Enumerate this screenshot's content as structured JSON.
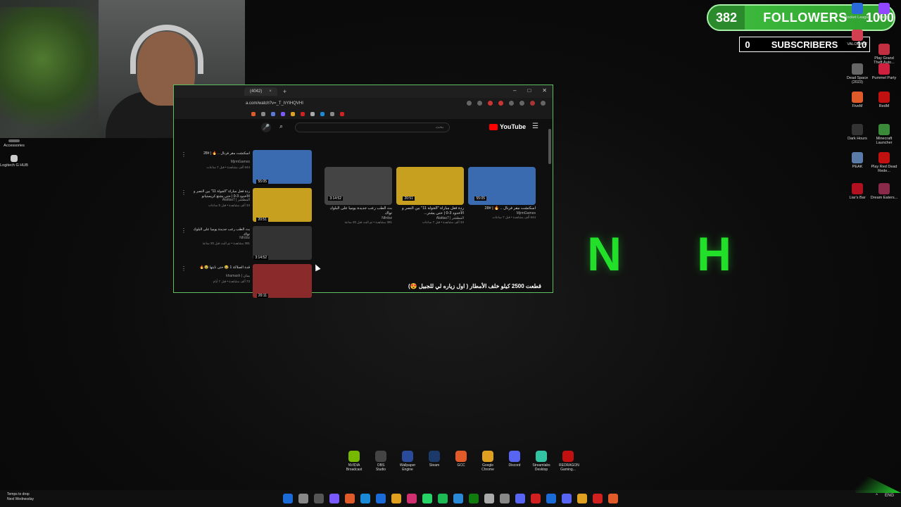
{
  "followers": {
    "count": "382",
    "label": "FOLLOWERS",
    "goal": "1000"
  },
  "subscribers": {
    "count": "0",
    "label": "SUBSCRIBERS",
    "goal": "10"
  },
  "big_letters": [
    "N",
    "H"
  ],
  "left_desktop": [
    {
      "label": "Accessories",
      "icon": "folder-icon"
    },
    {
      "label": "Logitech G HUB",
      "icon": "logitech-icon"
    }
  ],
  "right_desktop": [
    {
      "label": "Rocket League",
      "icon": "rocket-league-icon"
    },
    {
      "label": "Twitch",
      "icon": "twitch-icon"
    },
    {
      "label": "VALORANT",
      "icon": "valorant-icon"
    },
    {
      "label": "Play Grand Theft Auto...",
      "icon": "gta-icon"
    },
    {
      "label": "Dead Space (2023)",
      "icon": "dead-space-icon"
    },
    {
      "label": "Pummel Party",
      "icon": "pummel-party-icon"
    },
    {
      "label": "FiveM",
      "icon": "fivem-icon"
    },
    {
      "label": "RedM",
      "icon": "redm-icon"
    },
    {
      "label": "Dark Hours",
      "icon": "dark-hours-icon"
    },
    {
      "label": "Minecraft Launcher",
      "icon": "minecraft-icon"
    },
    {
      "label": "PEAK",
      "icon": "peak-icon"
    },
    {
      "label": "Play Red Dead Rede...",
      "icon": "rdr-icon"
    },
    {
      "label": "Liar's Bar",
      "icon": "liars-bar-icon"
    },
    {
      "label": "Dream Eaters...",
      "icon": "dream-eaters-icon"
    }
  ],
  "browser": {
    "tab_title": "(4042)",
    "url": "a.com/watch?v=_T_hYIHQVHI",
    "search_placeholder": "بحث",
    "logo": "YouTube",
    "sidebar": [
      {
        "title": "اسكتشت مقر فرنال .. 🔥 | #28",
        "channel": "MjrmGames",
        "meta": "644 ألف مشاهدة • قبل 7 ساعات",
        "duration": "55:05",
        "color": "#3a6ab0"
      },
      {
        "title": "ردة فعل مباراة \"الجولة 11\" بين النصر و الأخدود 3-0 | حتى يشتغ كريستيانو",
        "channel": "Alattas7 | المطشر",
        "meta": "34 ألف مشاهدة • قبل 5 ساعات",
        "duration": "20:51",
        "color": "#c8a020"
      },
      {
        "title": "بث الطب رعب جديدة يوميا على البلوك تواك",
        "channel": "Nfrdoz",
        "meta": "391 مشاهدة • تم البث قبل 20 ساعة",
        "duration": "3:14:52",
        "color": "#333"
      },
      {
        "title": "قدة الصلاكة 1 😂 حتى نايتها 😂🔥",
        "channel": "khamash | يمان",
        "meta": "73 ألف مشاهدة • قبل 7 أيام",
        "duration": "20:11",
        "color": "#8a2a2a"
      }
    ],
    "grid": [
      {
        "title": "اسكتشت مقر فرنال .. 🔥 | #28",
        "channel": "MjrmGames",
        "meta": "644 ألف مشاهدة • قبل 7 ساعات",
        "duration": "55:05",
        "color": "#3a6ab0"
      },
      {
        "title": "ردة فعل مباراة \"الجولة 11\" بين النصر و الأخدود 3-0 | حتى يشتر...",
        "channel": "Alattas7 | المطشر",
        "meta": "34 ألف مشاهدة • قبل 7 ساعات",
        "duration": "20:51",
        "color": "#c8a020"
      },
      {
        "title": "بث الطب رعب جديدة يوميا على البلوك تواك",
        "channel": "Nfrdoz",
        "meta": "391 مشاهدة • تم البث قبل 20 ساعة",
        "duration": "3:14:52",
        "color": "#444"
      }
    ],
    "video_title": "قطعت 2500 كيلو خلف الأمطار ( اول زياره لي للجبيل 😍)"
  },
  "dock": [
    {
      "label": "NVIDIA Broadcast",
      "icon": "nvidia-icon",
      "color": "#76b900"
    },
    {
      "label": "OBS Studio",
      "icon": "obs-icon",
      "color": "#444"
    },
    {
      "label": "Wallpaper Engine",
      "icon": "wallpaper-engine-icon",
      "color": "#2a4a9a"
    },
    {
      "label": "Steam",
      "icon": "steam-icon",
      "color": "#1b3a6a"
    },
    {
      "label": "GCC",
      "icon": "gcc-icon",
      "color": "#e05a2a"
    },
    {
      "label": "Google Chrome",
      "icon": "chrome-icon",
      "color": "#e0a020"
    },
    {
      "label": "Discord",
      "icon": "discord-icon",
      "color": "#5865f2"
    },
    {
      "label": "Streamlabs Desktop",
      "icon": "streamlabs-icon",
      "color": "#31c3a2"
    },
    {
      "label": "REDRAGON Gaming...",
      "icon": "redragon-icon",
      "color": "#c01010"
    }
  ],
  "taskbar": {
    "weather_line1": "Temps to drop",
    "weather_line2": "Next Wednesday",
    "lang": "ENG",
    "icons": [
      "#1a6ad8",
      "#888",
      "#555",
      "#7a5aff",
      "#e05a2a",
      "#1a8ad8",
      "#1a6ad8",
      "#e0a020",
      "#d03070",
      "#25d366",
      "#1db954",
      "#2a8ad8",
      "#107c10",
      "#aaa",
      "#888",
      "#5865f2",
      "#d02020",
      "#1a6ad8",
      "#5865f2",
      "#e0a020",
      "#d02020",
      "#e05a2a"
    ]
  }
}
